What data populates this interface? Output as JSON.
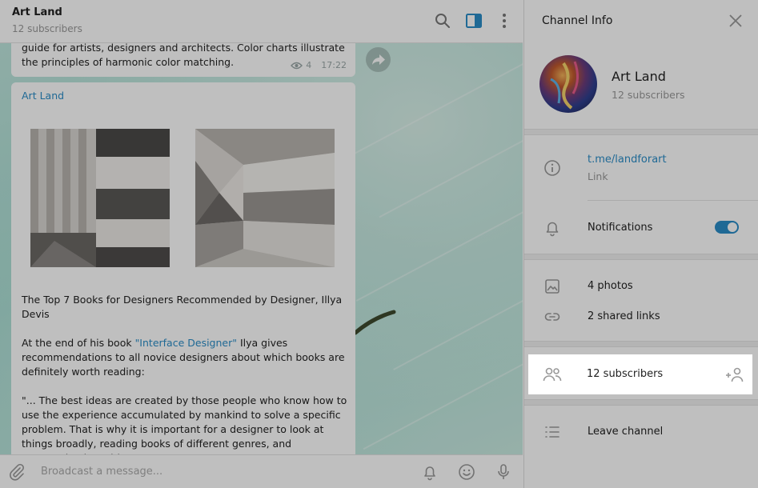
{
  "chat": {
    "title": "Art Land",
    "subtitle": "12 subscribers",
    "message1": {
      "text": "guide for artists, designers and architects. Color charts illustrate the principles of harmonic color matching.",
      "views": "4",
      "time": "17:22"
    },
    "message2": {
      "author": "Art Land",
      "title": "The Top 7 Books for Designers Recommended by Designer, Illya Devis",
      "p1_before": "At the end of his book ",
      "p1_link": "\"Interface Designer\"",
      "p1_after": " Ilya gives recommendations to all novice designers about which books are definitely worth reading:",
      "p2": "\"... The best ideas are created by those people who know how to use the experience accumulated by mankind to solve a specific problem. That is why it is important for a designer to look at things broadly, reading books of different genres, and communicating with"
    },
    "composer_placeholder": "Broadcast a message..."
  },
  "panel": {
    "title": "Channel Info",
    "name": "Art Land",
    "subscribers": "12 subscribers",
    "link_value": "t.me/landforart",
    "link_label": "Link",
    "notifications_label": "Notifications",
    "notifications_on": true,
    "photos": "4 photos",
    "shared_links": "2 shared links",
    "members": "12 subscribers",
    "leave": "Leave channel"
  },
  "colors": {
    "accent": "#2a8cc7",
    "muted": "#999999",
    "dim_overlay": "rgba(0,0,0,0.25)"
  },
  "icons": {
    "header": [
      "search-icon",
      "sidebar-toggle-icon",
      "more-vertical-icon"
    ],
    "composer": [
      "attach-icon",
      "bell-icon",
      "emoji-icon",
      "microphone-icon"
    ],
    "panel": [
      "close-icon",
      "info-icon",
      "bell-icon",
      "photo-icon",
      "link-icon",
      "group-icon",
      "add-user-icon",
      "list-icon"
    ]
  }
}
